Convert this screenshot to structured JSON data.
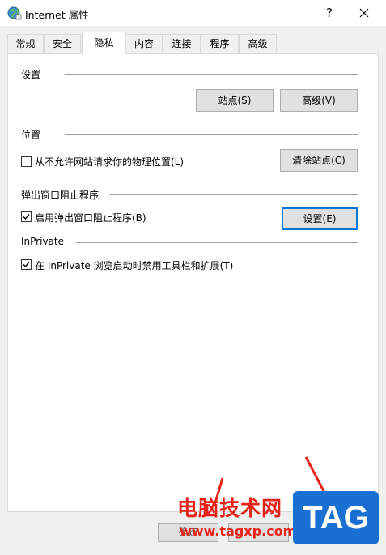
{
  "window": {
    "title": "Internet 属性",
    "help_label": "?"
  },
  "tabs": [
    {
      "label": "常规"
    },
    {
      "label": "安全"
    },
    {
      "label": "隐私"
    },
    {
      "label": "内容"
    },
    {
      "label": "连接"
    },
    {
      "label": "程序"
    },
    {
      "label": "高级"
    }
  ],
  "active_tab": "隐私",
  "settings_group": {
    "title": "设置",
    "sites_button": "站点(S)",
    "advanced_button": "高级(V)"
  },
  "location_group": {
    "title": "位置",
    "checkbox_label": "从不允许网站请求你的物理位置(L)",
    "checkbox_checked": false,
    "clear_sites_button": "清除站点(C)"
  },
  "popup_group": {
    "title": "弹出窗口阻止程序",
    "checkbox_label": "启用弹出窗口阻止程序(B)",
    "checkbox_checked": true,
    "settings_button": "设置(E)"
  },
  "inprivate_group": {
    "title": "InPrivate",
    "checkbox_label": "在 InPrivate 浏览启动时禁用工具栏和扩展(T)",
    "checkbox_checked": true
  },
  "footer": {
    "ok_button": "确定"
  },
  "watermark": {
    "site_name": "电脑技术网",
    "url": "www.tagxp.com",
    "badge": "TAG"
  },
  "colors": {
    "accent": "#0078d7",
    "watermark_red": "#e8231a",
    "watermark_blue": "#1a6fd3"
  }
}
